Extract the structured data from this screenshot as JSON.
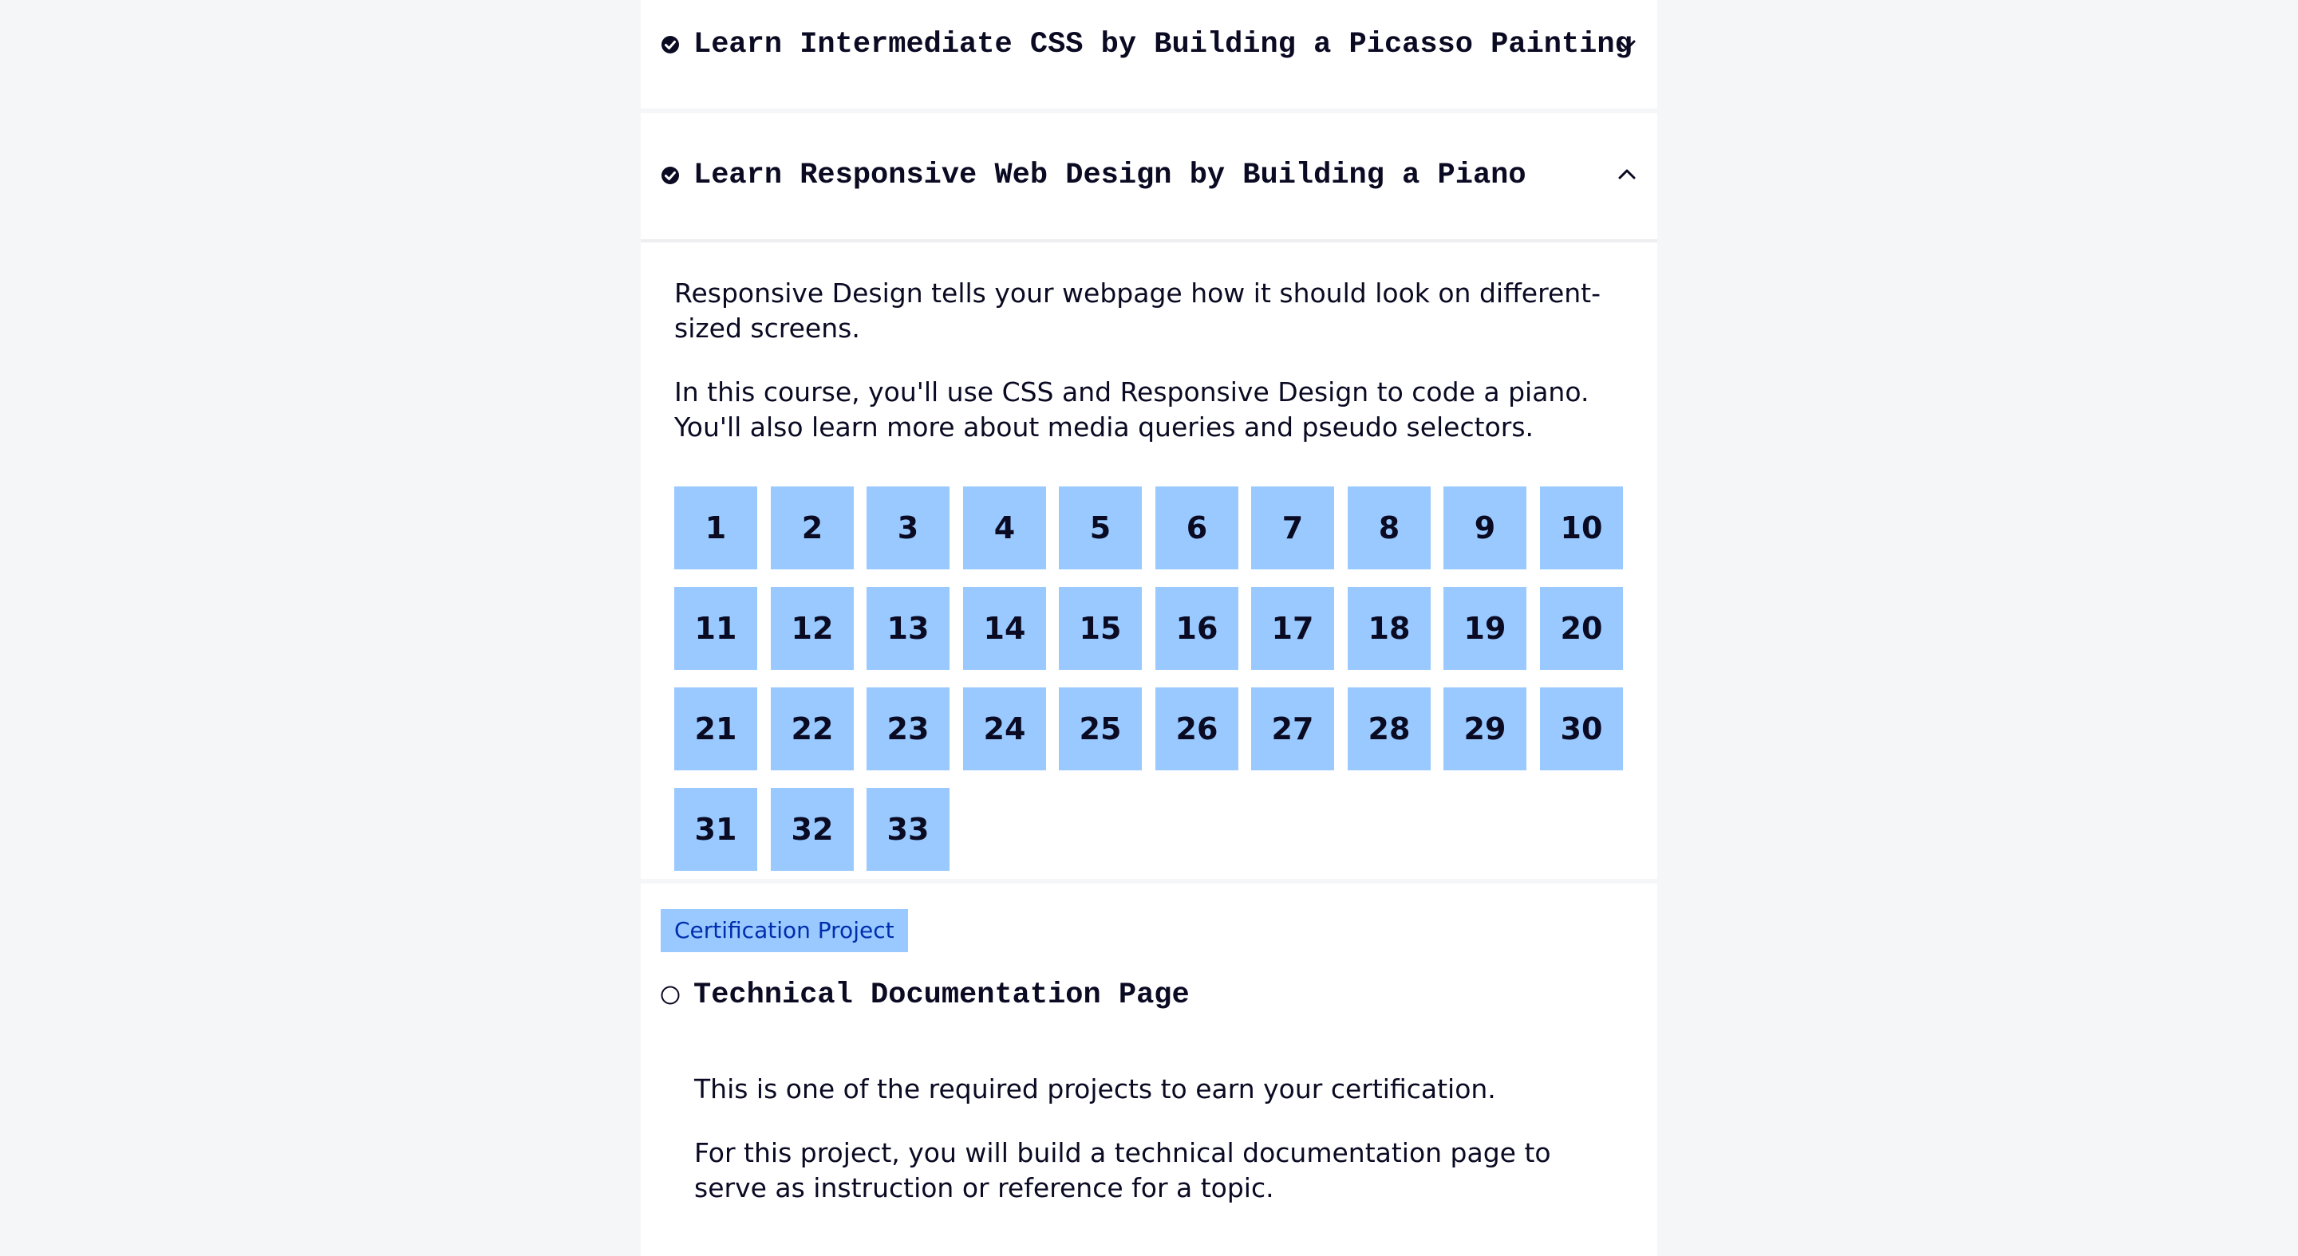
{
  "blocks": [
    {
      "title": "Learn Intermediate CSS by Building a Picasso Painting",
      "status_icon": "check-circle-icon",
      "expanded": false,
      "toggle_icon": "chevron-down-icon"
    },
    {
      "title": "Learn Responsive Web Design by Building a Piano",
      "status_icon": "check-circle-icon",
      "expanded": true,
      "toggle_icon": "chevron-up-icon",
      "description": [
        "Responsive Design tells your webpage how it should look on different-sized screens.",
        "In this course, you'll use CSS and Responsive Design to code a piano. You'll also learn more about media queries and pseudo selectors."
      ],
      "steps": [
        "1",
        "2",
        "3",
        "4",
        "5",
        "6",
        "7",
        "8",
        "9",
        "10",
        "11",
        "12",
        "13",
        "14",
        "15",
        "16",
        "17",
        "18",
        "19",
        "20",
        "21",
        "22",
        "23",
        "24",
        "25",
        "26",
        "27",
        "28",
        "29",
        "30",
        "31",
        "32",
        "33"
      ]
    }
  ],
  "project": {
    "badge": "Certification Project",
    "title": "Technical Documentation Page",
    "status_icon": "empty-circle-icon",
    "description": [
      "This is one of the required projects to earn your certification.",
      "For this project, you will build a technical documentation page to serve as instruction or reference for a topic."
    ]
  },
  "colors": {
    "background": "#f5f6f7",
    "panel": "#ffffff",
    "step_tile": "#99c9ff",
    "text": "#0a0a23",
    "badge_text": "#002ead"
  }
}
